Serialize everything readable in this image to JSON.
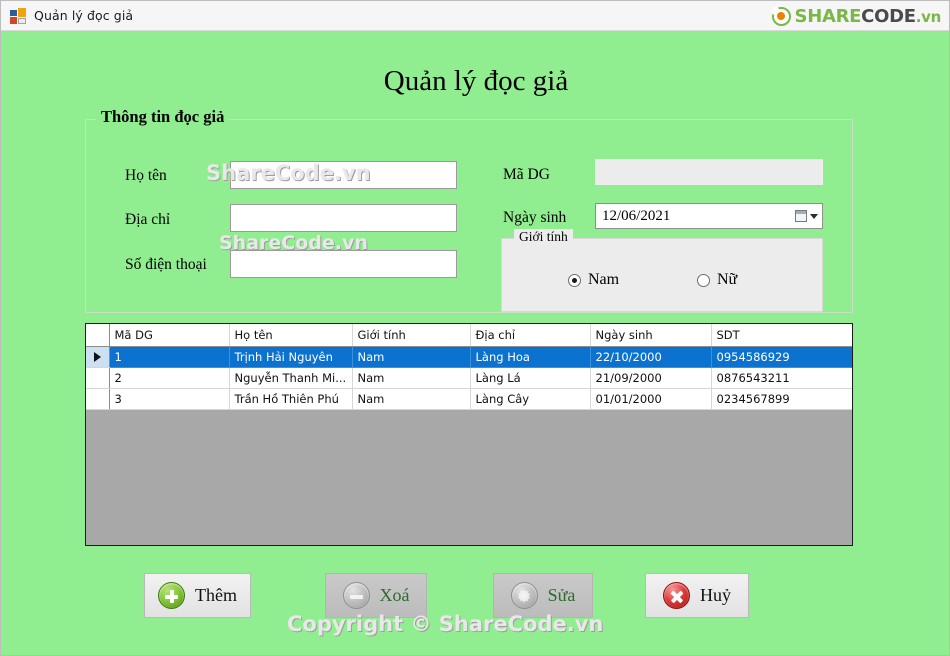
{
  "window": {
    "title": "Quản lý đọc giả",
    "icon": "windows-form-icon",
    "background_color": "#90ee90"
  },
  "brand": {
    "share": "SHARE",
    "code": "CODE",
    "vn": ".vn"
  },
  "form": {
    "title": "Quản lý đọc giả",
    "groupbox_legend": "Thông tin đọc giả",
    "fields": {
      "fullname": {
        "label": "Họ tên",
        "value": "",
        "placeholder": ""
      },
      "address": {
        "label": "Địa chỉ",
        "value": "",
        "placeholder": ""
      },
      "phone": {
        "label": "Số điện thoại",
        "value": "",
        "placeholder": ""
      },
      "reader_id": {
        "label": "Mã DG",
        "value": "",
        "placeholder": ""
      },
      "birthdate": {
        "label": "Ngày sinh",
        "value": "12/06/2021"
      }
    },
    "gender": {
      "legend": "Giới tính",
      "options": [
        {
          "label": "Nam",
          "selected": true
        },
        {
          "label": "Nữ",
          "selected": false
        }
      ]
    }
  },
  "grid": {
    "columns": [
      "Mã DG",
      "Họ tên",
      "Giới tính",
      "Địa chỉ",
      "Ngày sinh",
      "SDT"
    ],
    "rows": [
      {
        "selected": true,
        "cells": [
          "1",
          "Trịnh Hải Nguyên",
          "Nam",
          "Làng Hoa",
          "22/10/2000",
          "0954586929"
        ]
      },
      {
        "selected": false,
        "cells": [
          "2",
          "Nguyễn Thanh Mi...",
          "Nam",
          "Làng Lá",
          "21/09/2000",
          "0876543211"
        ]
      },
      {
        "selected": false,
        "cells": [
          "3",
          "Trần Hồ Thiên Phú",
          "Nam",
          "Làng Cây",
          "01/01/2000",
          "0234567899"
        ]
      }
    ],
    "selection_color": "#0b72cf",
    "empty_area_color": "#a8a8a8"
  },
  "buttons": [
    {
      "label": "Thêm",
      "icon": "plus-circle-icon",
      "state": "enabled"
    },
    {
      "label": "Xoá",
      "icon": "minus-circle-icon",
      "state": "disabled"
    },
    {
      "label": "Sửa",
      "icon": "gear-circle-icon",
      "state": "disabled"
    },
    {
      "label": "Huỷ",
      "icon": "x-circle-icon",
      "state": "enabled"
    }
  ],
  "watermarks": {
    "one": "ShareCode.vn",
    "two": "ShareCode.vn",
    "copyright": "Copyright © ShareCode.vn"
  }
}
